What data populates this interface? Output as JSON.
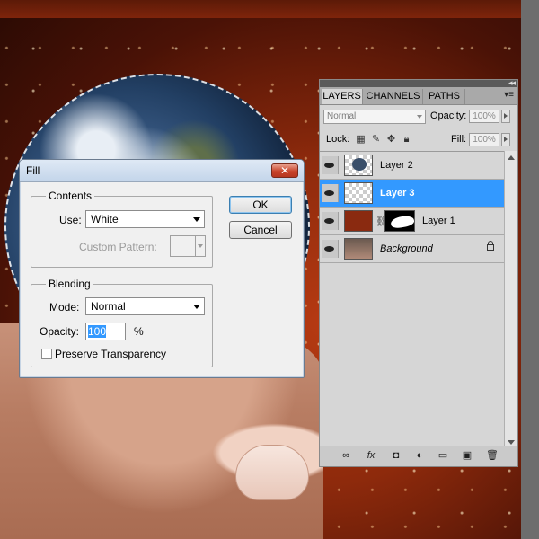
{
  "fill_dialog": {
    "title": "Fill",
    "close_label": "✕",
    "contents": {
      "legend": "Contents",
      "use_label": "Use:",
      "use_value": "White",
      "custom_pattern_label": "Custom Pattern:"
    },
    "blending": {
      "legend": "Blending",
      "mode_label": "Mode:",
      "mode_value": "Normal",
      "opacity_label": "Opacity:",
      "opacity_value": "100",
      "opacity_unit": "%",
      "preserve_label": "Preserve Transparency"
    },
    "ok_label": "OK",
    "cancel_label": "Cancel"
  },
  "layers_panel": {
    "tabs": [
      "LAYERS",
      "CHANNELS",
      "PATHS"
    ],
    "blend_mode": "Normal",
    "opacity_label": "Opacity:",
    "opacity_value": "100%",
    "lock_label": "Lock:",
    "fill_label": "Fill:",
    "fill_value": "100%",
    "layers": [
      {
        "name": "Layer 2",
        "selected": false
      },
      {
        "name": "Layer 3",
        "selected": true
      },
      {
        "name": "Layer 1",
        "selected": false
      },
      {
        "name": "Background",
        "selected": false
      }
    ]
  },
  "colors": {
    "selection_blue": "#3399ff",
    "dialog_bg": "#f0f0f0",
    "panel_bg": "#d6d6d6"
  }
}
